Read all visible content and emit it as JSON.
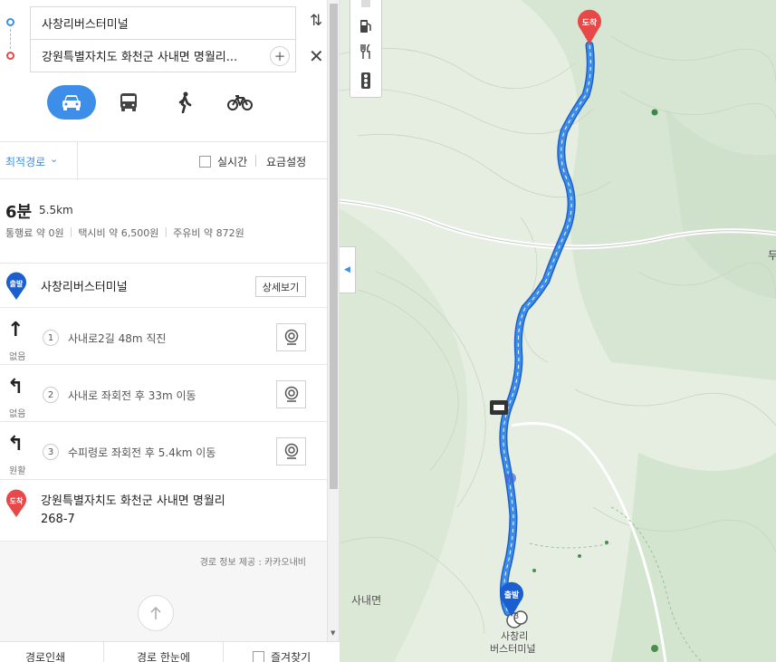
{
  "route": {
    "start": "사창리버스터미널",
    "end": "강원특별자치도 화천군 사내면 명월리...",
    "plus": "+",
    "swap": "⇅",
    "close": "✕"
  },
  "modes": [
    {
      "name": "car",
      "active": true
    },
    {
      "name": "bus",
      "active": false
    },
    {
      "name": "walk",
      "active": false
    },
    {
      "name": "bike",
      "active": false
    }
  ],
  "options": {
    "preference": "최적경로",
    "realtime": "실시간",
    "fare": "요금설정"
  },
  "summary": {
    "time": "6분",
    "distance": "5.5km",
    "toll": "통행료 약 0원",
    "taxi": "택시비 약 6,500원",
    "fuel": "주유비 약 872원",
    "sep": "|"
  },
  "origin": {
    "badge": "출발",
    "name": "사창리버스터미널",
    "detail_button": "상세보기"
  },
  "steps": [
    {
      "num": "1",
      "arrow": "↑",
      "road": "없음",
      "text": "사내로2길 48m 직진"
    },
    {
      "num": "2",
      "arrow": "↰",
      "road": "없음",
      "text": "사내로 좌회전 후 33m 이동"
    },
    {
      "num": "3",
      "arrow": "↰",
      "road": "원활",
      "text": "수피령로 좌회전 후 5.4km 이동"
    }
  ],
  "destination": {
    "badge": "도착",
    "line1": "강원특별자치도 화천군 사내면 명월리",
    "line2": "268-7"
  },
  "source": "경로 정보 제공 : 카카오내비",
  "footer": {
    "print": "경로인쇄",
    "overview": "경로 한눈에",
    "favorite": "즐겨찾기"
  },
  "map": {
    "end_pin": "도착",
    "start_pin": "출발",
    "area_label": "사내면",
    "poi_line1": "사창리",
    "poi_line2": "버스터미널",
    "edge_label": "두",
    "stop_num": "3",
    "route_color": "#3d8ee8",
    "end_color": "#e84848"
  },
  "colors": {
    "accent": "#3d8ee8",
    "destination": "#e84848"
  }
}
